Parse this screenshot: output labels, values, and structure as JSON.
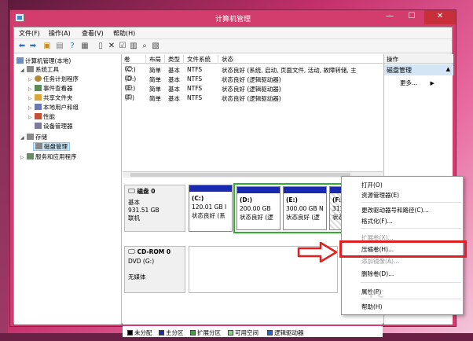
{
  "window": {
    "title": "计算机管理"
  },
  "menu": {
    "file": "文件(F)",
    "action": "操作(A)",
    "view": "查看(V)",
    "help": "帮助(H)"
  },
  "tree": {
    "root": "计算机管理(本地)",
    "system_tools": "系统工具",
    "task_scheduler": "任务计划程序",
    "event_viewer": "事件查看器",
    "shared_folders": "共享文件夹",
    "local_users": "本地用户和组",
    "performance": "性能",
    "device_manager": "设备管理器",
    "storage": "存储",
    "disk_management": "磁盘管理",
    "services_apps": "服务和应用程序"
  },
  "volume_table": {
    "headers": [
      "卷",
      "布局",
      "类型",
      "文件系统",
      "状态"
    ],
    "rows": [
      {
        "vol": "(C:)",
        "layout": "简单",
        "type": "基本",
        "fs": "NTFS",
        "status": "状态良好 (系统, 启动, 页面文件, 活动, 故障转储, 主"
      },
      {
        "vol": "(D:)",
        "layout": "简单",
        "type": "基本",
        "fs": "NTFS",
        "status": "状态良好 (逻辑驱动器)"
      },
      {
        "vol": "(E:)",
        "layout": "简单",
        "type": "基本",
        "fs": "NTFS",
        "status": "状态良好 (逻辑驱动器)"
      },
      {
        "vol": "(F:)",
        "layout": "简单",
        "type": "基本",
        "fs": "NTFS",
        "status": "状态良好 (逻辑驱动器)"
      }
    ]
  },
  "disk0": {
    "name": "磁盘 0",
    "type": "基本",
    "size": "931.51 GB",
    "state": "联机",
    "partitions": [
      {
        "label": "(C:)",
        "size": "120.01 GB I",
        "status": "状态良好 (系"
      },
      {
        "label": "(D:)",
        "size": "200.00 GB",
        "status": "状态良好 (逻"
      },
      {
        "label": "(E:)",
        "size": "300.00 GB N",
        "status": "状态良好 (逻"
      },
      {
        "label": "(F:",
        "size": "311",
        "status": "状态"
      }
    ]
  },
  "cdrom": {
    "name": "CD-ROM 0",
    "drive": "DVD (G:)",
    "media": "无媒体"
  },
  "legend": [
    "未分配",
    "主分区",
    "扩展分区",
    "可用空间",
    "逻辑驱动器"
  ],
  "legend_colors": [
    "#000000",
    "#1a2ab0",
    "#2fae2f",
    "#7cd97c",
    "#2060ff"
  ],
  "actions": {
    "title": "操作",
    "selected": "磁盘管理",
    "more": "更多..."
  },
  "context_menu": {
    "open": "打开(O)",
    "explore": "资源管理器(E)",
    "change_letter": "更改驱动器号和路径(C)...",
    "format": "格式化(F)...",
    "extend": "扩展卷(X)...",
    "shrink": "压缩卷(H)...",
    "add_mirror": "添加镜像(A)...",
    "delete": "删除卷(D)...",
    "properties": "属性(P)",
    "help": "帮助(H)"
  },
  "watermark": "PC"
}
